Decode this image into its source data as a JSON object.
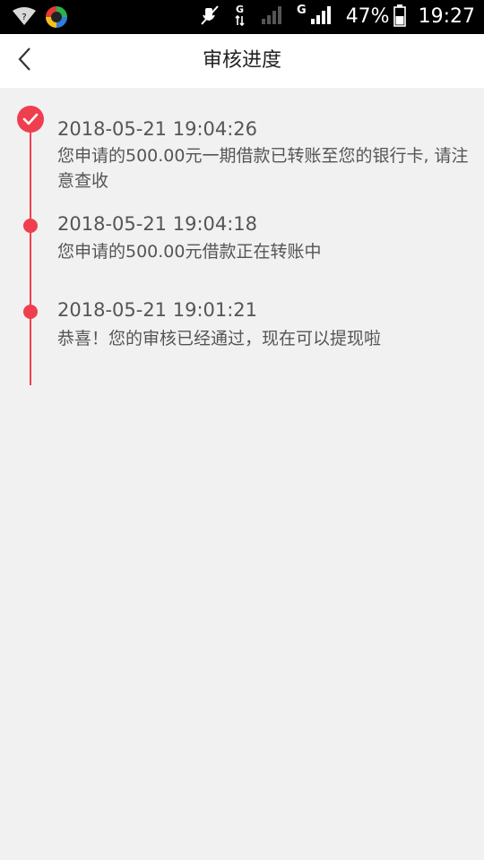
{
  "status_bar": {
    "battery_percent": "47%",
    "time": "19:27",
    "network_label_1": "G",
    "network_label_2": "G",
    "icons": [
      "signal-icon",
      "app-icon",
      "mute-icon",
      "data-icon",
      "cell-signal-icon",
      "battery-icon"
    ]
  },
  "nav": {
    "title": "审核进度",
    "back_icon": "chevron-left-icon"
  },
  "timeline": {
    "accent_color": "#ef3f4f",
    "items": [
      {
        "time": "2018-05-21 19:04:26",
        "message": "您申请的500.00元一期借款已转账至您的银行卡, 请注意查收",
        "marker": "check"
      },
      {
        "time": "2018-05-21 19:04:18",
        "message": "您申请的500.00元借款正在转账中",
        "marker": "dot"
      },
      {
        "time": "2018-05-21 19:01:21",
        "message": "恭喜！您的审核已经通过，现在可以提现啦",
        "marker": "dot"
      }
    ]
  }
}
